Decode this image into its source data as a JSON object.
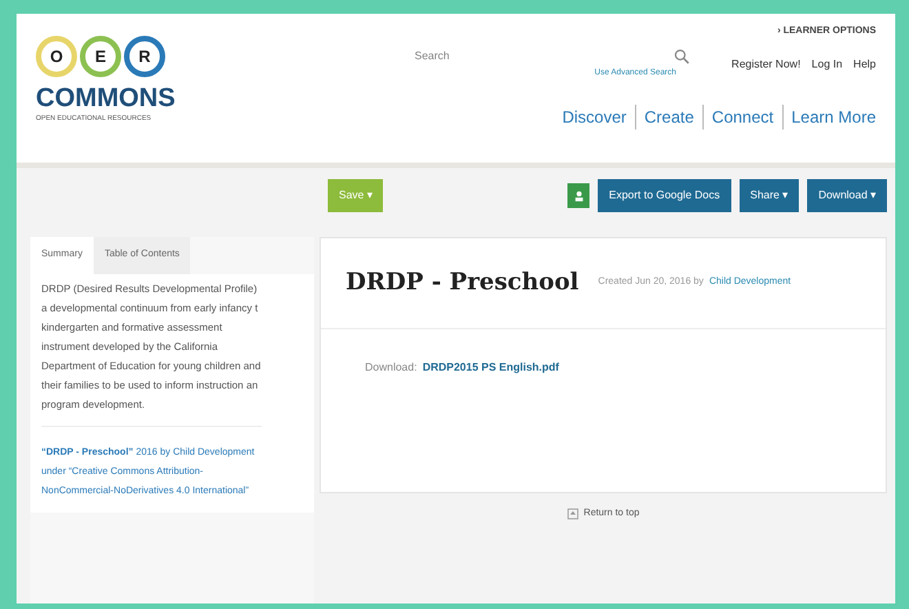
{
  "logo": {
    "letters": [
      {
        "text": "O",
        "color": "#e8d56a"
      },
      {
        "text": "E",
        "color": "#8cc152"
      },
      {
        "text": "R",
        "color": "#2a7ab8"
      }
    ],
    "name": "COMMONS",
    "tagline": "OPEN EDUCATIONAL RESOURCES"
  },
  "learner_options": "› LEARNER OPTIONS",
  "search": {
    "placeholder": "Search",
    "advanced_link": "Use Advanced Search"
  },
  "user_links": [
    "Register Now!",
    "Log In",
    "Help"
  ],
  "nav": [
    "Discover",
    "Create",
    "Connect",
    "Learn More"
  ],
  "toolbar": {
    "save": "Save ▾",
    "export": "Export to Google Docs",
    "share": "Share ▾",
    "download": "Download ▾"
  },
  "sidebar": {
    "tabs": [
      {
        "label": "Summary",
        "selected": true
      },
      {
        "label": "Table of Contents",
        "selected": false
      }
    ],
    "summary_lines": [
      "DRDP (Desired Results Developmental Profile)",
      "a developmental continuum from early infancy t",
      "kindergarten and formative assessment",
      "instrument developed by the California",
      "Department of Education for young children and",
      "their families to be used to inform instruction an",
      "program development."
    ],
    "attribution": "**“DRDP - Preschool”** 2016 by Child Development under “Creative Commons Attribution-NonCommercial-NoDerivatives 4.0 International”"
  },
  "resource": {
    "title": "DRDP - Preschool",
    "created": "Created Jun 20, 2016 by",
    "author": "Child Development",
    "download_label": "Download:",
    "file": "DRDP2015 PS English.pdf"
  },
  "return_to_top": "Return to top"
}
